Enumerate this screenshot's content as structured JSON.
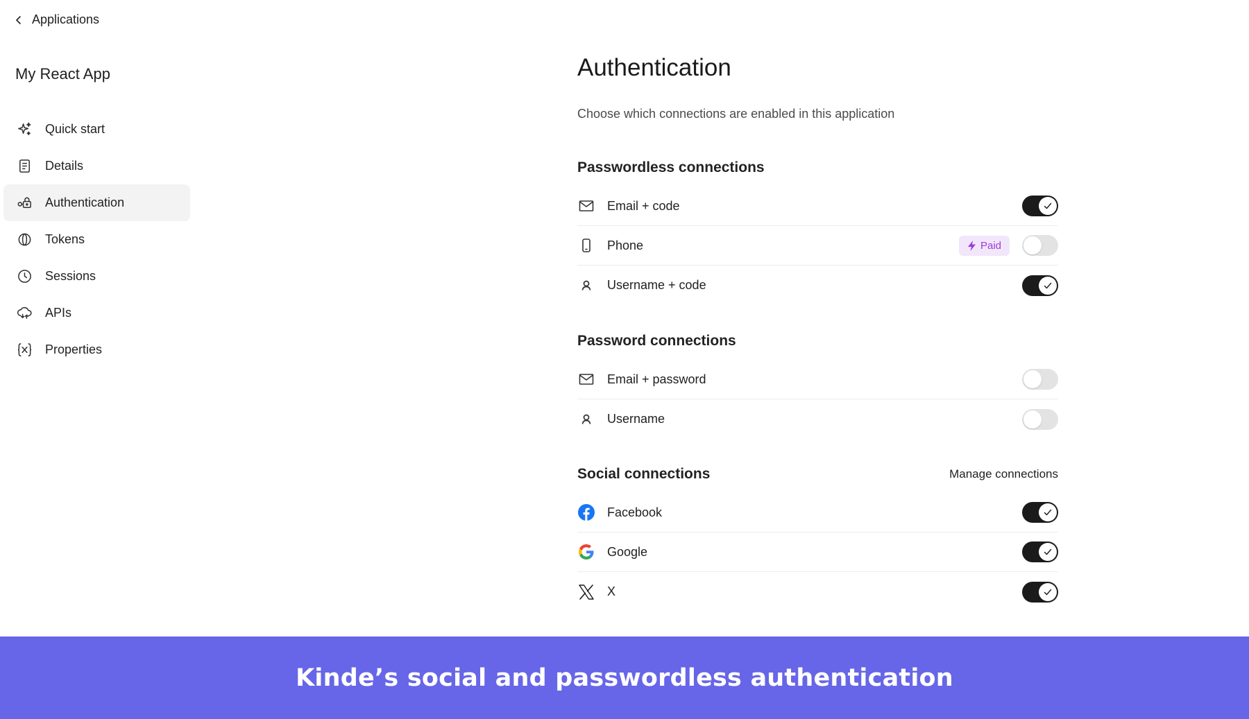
{
  "colors": {
    "banner_bg": "#6766e8",
    "toggle_on": "#1b1b1b",
    "toggle_off": "#e3e3e3",
    "paid_bg": "#f2e6fb",
    "paid_text": "#9b3fd6",
    "active_nav_bg": "#f3f3f3"
  },
  "nav": {
    "back_label": "Applications",
    "app_title": "My React App",
    "items": [
      {
        "label": "Quick start",
        "icon": "sparkles-icon",
        "active": false
      },
      {
        "label": "Details",
        "icon": "document-icon",
        "active": false
      },
      {
        "label": "Authentication",
        "icon": "key-lock-icon",
        "active": true
      },
      {
        "label": "Tokens",
        "icon": "token-icon",
        "active": false
      },
      {
        "label": "Sessions",
        "icon": "clock-icon",
        "active": false
      },
      {
        "label": "APIs",
        "icon": "cloud-sync-icon",
        "active": false
      },
      {
        "label": "Properties",
        "icon": "variable-icon",
        "active": false
      }
    ]
  },
  "main": {
    "title": "Authentication",
    "subtitle": "Choose which connections are enabled in this application",
    "sections": {
      "passwordless": {
        "title": "Passwordless connections",
        "rows": [
          {
            "label": "Email + code",
            "icon": "mail-icon",
            "enabled": true
          },
          {
            "label": "Phone",
            "icon": "phone-icon",
            "enabled": false,
            "badge": "Paid"
          },
          {
            "label": "Username + code",
            "icon": "user-icon",
            "enabled": true
          }
        ]
      },
      "password": {
        "title": "Password connections",
        "rows": [
          {
            "label": "Email + password",
            "icon": "mail-icon",
            "enabled": false
          },
          {
            "label": "Username",
            "icon": "user-icon",
            "enabled": false
          }
        ]
      },
      "social": {
        "title": "Social connections",
        "manage_label": "Manage connections",
        "rows": [
          {
            "label": "Facebook",
            "icon": "facebook-icon",
            "enabled": true
          },
          {
            "label": "Google",
            "icon": "google-icon",
            "enabled": true
          },
          {
            "label": "X",
            "icon": "x-logo-icon",
            "enabled": true
          }
        ]
      }
    }
  },
  "banner": {
    "text": "Kinde’s social and passwordless authentication"
  }
}
